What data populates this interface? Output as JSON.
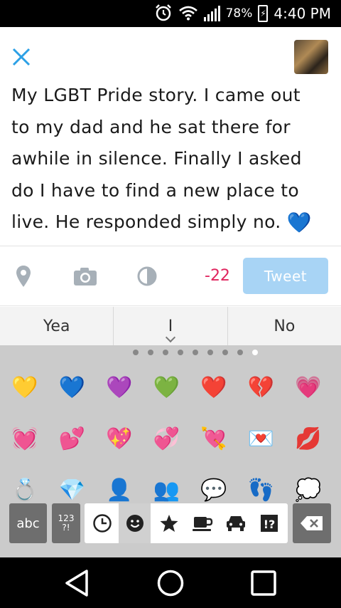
{
  "status_bar": {
    "battery": "78%",
    "time": "4:40 PM"
  },
  "compose": {
    "lines": [
      "My LGBT Pride story. I came out",
      "to my dad and he sat there for",
      "awhile in silence. Finally I asked",
      "do I have to find a new place to",
      "live. He responded simply no. "
    ],
    "trailing_emoji": "💙"
  },
  "toolbar": {
    "char_count": "-22",
    "tweet_label": "Tweet",
    "icons": [
      "location-pin-icon",
      "camera-icon",
      "poll-icon"
    ],
    "colors": {
      "accent": "#2ca0e6",
      "counter": "#e0245e",
      "tweet_disabled": "#a8d4f5"
    }
  },
  "suggestions": [
    "Yea",
    "I",
    "No"
  ],
  "emoji_keyboard": {
    "rows": [
      [
        "💛",
        "💙",
        "💜",
        "💚",
        "❤️",
        "💔",
        "💗"
      ],
      [
        "💓",
        "💕",
        "💖",
        "💞",
        "💘",
        "💌",
        "💋"
      ],
      [
        "💍",
        "💎",
        "👤",
        "👥",
        "💬",
        "👣",
        "💭"
      ]
    ],
    "abc_label": "abc",
    "num_label": "123\n?!",
    "categories": [
      "recent-clock-icon",
      "smiley-icon",
      "star-icon",
      "coffee-cup-icon",
      "car-icon",
      "symbols-icon"
    ],
    "page_count": 9,
    "active_page": 9
  }
}
